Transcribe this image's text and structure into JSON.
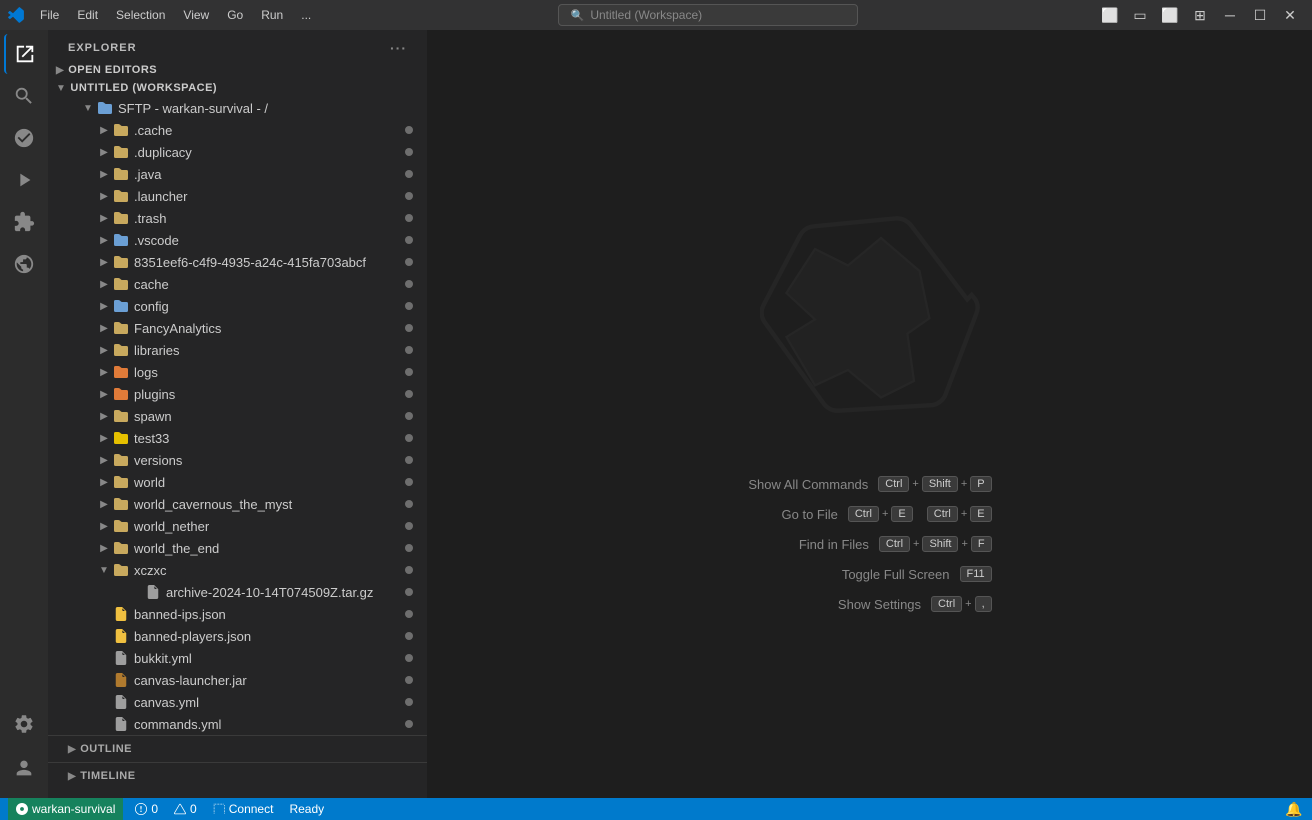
{
  "titlebar": {
    "logo": "VS",
    "menu_items": [
      "File",
      "Edit",
      "Selection",
      "View",
      "Go",
      "Run",
      "..."
    ],
    "search_placeholder": "Untitled (Workspace)",
    "window_buttons": [
      "minimize",
      "maximize",
      "close"
    ]
  },
  "activity_bar": {
    "icons": [
      {
        "name": "explorer-icon",
        "symbol": "📄",
        "active": true
      },
      {
        "name": "search-icon",
        "symbol": "🔍"
      },
      {
        "name": "source-control-icon",
        "symbol": "⑂"
      },
      {
        "name": "run-debug-icon",
        "symbol": "▷"
      },
      {
        "name": "extensions-icon",
        "symbol": "⊞"
      },
      {
        "name": "remote-explorer-icon",
        "symbol": "⊙"
      }
    ],
    "bottom_icons": [
      {
        "name": "settings-icon",
        "symbol": "⚙"
      },
      {
        "name": "account-icon",
        "symbol": "👤"
      }
    ]
  },
  "sidebar": {
    "title": "EXPLORER",
    "sections": {
      "open_editors": "OPEN EDITORS",
      "workspace": "UNTITLED (WORKSPACE)",
      "sftp_root": "SFTP - warkan-survival - /"
    },
    "tree_items": [
      {
        "indent": 24,
        "type": "folder",
        "icon_color": "grey",
        "label": ".cache",
        "badge": true
      },
      {
        "indent": 24,
        "type": "folder",
        "icon_color": "grey",
        "label": ".duplicacy",
        "badge": true
      },
      {
        "indent": 24,
        "type": "folder",
        "icon_color": "grey",
        "label": ".java",
        "badge": true
      },
      {
        "indent": 24,
        "type": "folder",
        "icon_color": "grey",
        "label": ".launcher",
        "badge": true
      },
      {
        "indent": 24,
        "type": "folder",
        "icon_color": "grey",
        "label": ".trash",
        "badge": true
      },
      {
        "indent": 24,
        "type": "folder",
        "icon_color": "blue",
        "label": ".vscode",
        "badge": true
      },
      {
        "indent": 24,
        "type": "folder",
        "icon_color": "grey",
        "label": "8351eef6-c4f9-4935-a24c-415fa703abcf",
        "badge": true
      },
      {
        "indent": 24,
        "type": "folder",
        "icon_color": "grey",
        "label": "cache",
        "badge": true
      },
      {
        "indent": 24,
        "type": "folder",
        "icon_color": "blue",
        "label": "config",
        "badge": true
      },
      {
        "indent": 24,
        "type": "folder",
        "icon_color": "grey",
        "label": "FancyAnalytics",
        "badge": true
      },
      {
        "indent": 24,
        "type": "folder",
        "icon_color": "grey",
        "label": "libraries",
        "badge": true
      },
      {
        "indent": 24,
        "type": "folder",
        "icon_color": "orange",
        "label": "logs",
        "badge": true
      },
      {
        "indent": 24,
        "type": "folder",
        "icon_color": "orange",
        "label": "plugins",
        "badge": true
      },
      {
        "indent": 24,
        "type": "folder",
        "icon_color": "grey",
        "label": "spawn",
        "badge": true
      },
      {
        "indent": 24,
        "type": "folder",
        "icon_color": "yellow",
        "label": "test33",
        "badge": true
      },
      {
        "indent": 24,
        "type": "folder",
        "icon_color": "grey",
        "label": "versions",
        "badge": true
      },
      {
        "indent": 24,
        "type": "folder",
        "icon_color": "grey",
        "label": "world",
        "badge": true
      },
      {
        "indent": 24,
        "type": "folder",
        "icon_color": "grey",
        "label": "world_cavernous_the_myst",
        "badge": true
      },
      {
        "indent": 24,
        "type": "folder",
        "icon_color": "grey",
        "label": "world_nether",
        "badge": true
      },
      {
        "indent": 24,
        "type": "folder",
        "icon_color": "grey",
        "label": "world_the_end",
        "badge": true
      },
      {
        "indent": 24,
        "type": "folder",
        "icon_color": "grey",
        "label": "xczxc",
        "badge": true,
        "expanded": true
      },
      {
        "indent": 40,
        "type": "file",
        "icon_color": "grey",
        "label": "archive-2024-10-14T074509Z.tar.gz",
        "badge": true
      },
      {
        "indent": 24,
        "type": "file",
        "icon_color": "json",
        "label": "banned-ips.json",
        "badge": true
      },
      {
        "indent": 24,
        "type": "file",
        "icon_color": "json",
        "label": "banned-players.json",
        "badge": true
      },
      {
        "indent": 24,
        "type": "file",
        "icon_color": "yaml",
        "label": "bukkit.yml",
        "badge": true
      },
      {
        "indent": 24,
        "type": "file",
        "icon_color": "jar",
        "label": "canvas-launcher.jar",
        "badge": true
      },
      {
        "indent": 24,
        "type": "file",
        "icon_color": "yaml",
        "label": "canvas.yml",
        "badge": true
      },
      {
        "indent": 24,
        "type": "file",
        "icon_color": "yaml",
        "label": "commands.yml",
        "badge": true
      }
    ],
    "outline": "OUTLINE",
    "timeline": "TIMELINE"
  },
  "editor": {
    "shortcuts": [
      {
        "label": "Show All Commands",
        "keys": [
          "Ctrl",
          "+",
          "Shift",
          "+",
          "P"
        ]
      },
      {
        "label": "Go to File",
        "keys": [
          "Ctrl",
          "+",
          "E",
          "Ctrl",
          "+",
          "E"
        ]
      },
      {
        "label": "Find in Files",
        "keys": [
          "Ctrl",
          "+",
          "Shift",
          "+",
          "F"
        ]
      },
      {
        "label": "Toggle Full Screen",
        "keys": [
          "F11"
        ]
      },
      {
        "label": "Show Settings",
        "keys": [
          "Ctrl",
          "+",
          ","
        ]
      }
    ]
  },
  "statusbar": {
    "left_label": "warkan-survival",
    "errors": "0",
    "warnings": "0",
    "connect_label": "Connect",
    "ready_label": "Ready"
  }
}
